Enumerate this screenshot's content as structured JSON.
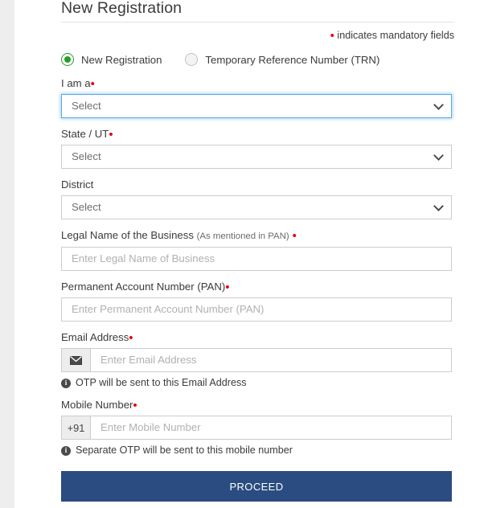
{
  "header": {
    "title": "New Registration",
    "mandatory_note": "indicates mandatory fields",
    "mandatory_marker": "•"
  },
  "registration_type": {
    "options": [
      {
        "label": "New Registration",
        "selected": true
      },
      {
        "label": "Temporary Reference Number (TRN)",
        "selected": false
      }
    ]
  },
  "fields": {
    "i_am_a": {
      "label": "I am a",
      "required_marker": "•",
      "value": "Select",
      "focused": true
    },
    "state_ut": {
      "label": "State / UT",
      "required_marker": "•",
      "value": "Select"
    },
    "district": {
      "label": "District",
      "value": "Select"
    },
    "legal_name": {
      "label": "Legal Name of the Business",
      "label_sub": "(As mentioned in PAN)",
      "required_marker": "•",
      "placeholder": "Enter Legal Name of Business",
      "value": ""
    },
    "pan": {
      "label": "Permanent Account Number (PAN)",
      "required_marker": "•",
      "placeholder": "Enter Permanent Account Number (PAN)",
      "value": ""
    },
    "email": {
      "label": "Email Address",
      "required_marker": "•",
      "placeholder": "Enter Email Address",
      "value": "",
      "addon_icon": "envelope-icon",
      "hint": "OTP will be sent to this Email Address"
    },
    "mobile": {
      "label": "Mobile Number",
      "required_marker": "•",
      "country_code": "+91",
      "placeholder": "Enter Mobile Number",
      "value": "",
      "hint": "Separate OTP will be sent to this mobile number"
    }
  },
  "actions": {
    "proceed_label": "PROCEED"
  },
  "colors": {
    "mandatory_red": "#e60000",
    "radio_green": "#24a024",
    "proceed_blue": "#2a4c80",
    "focus_blue": "#5aaae0"
  }
}
